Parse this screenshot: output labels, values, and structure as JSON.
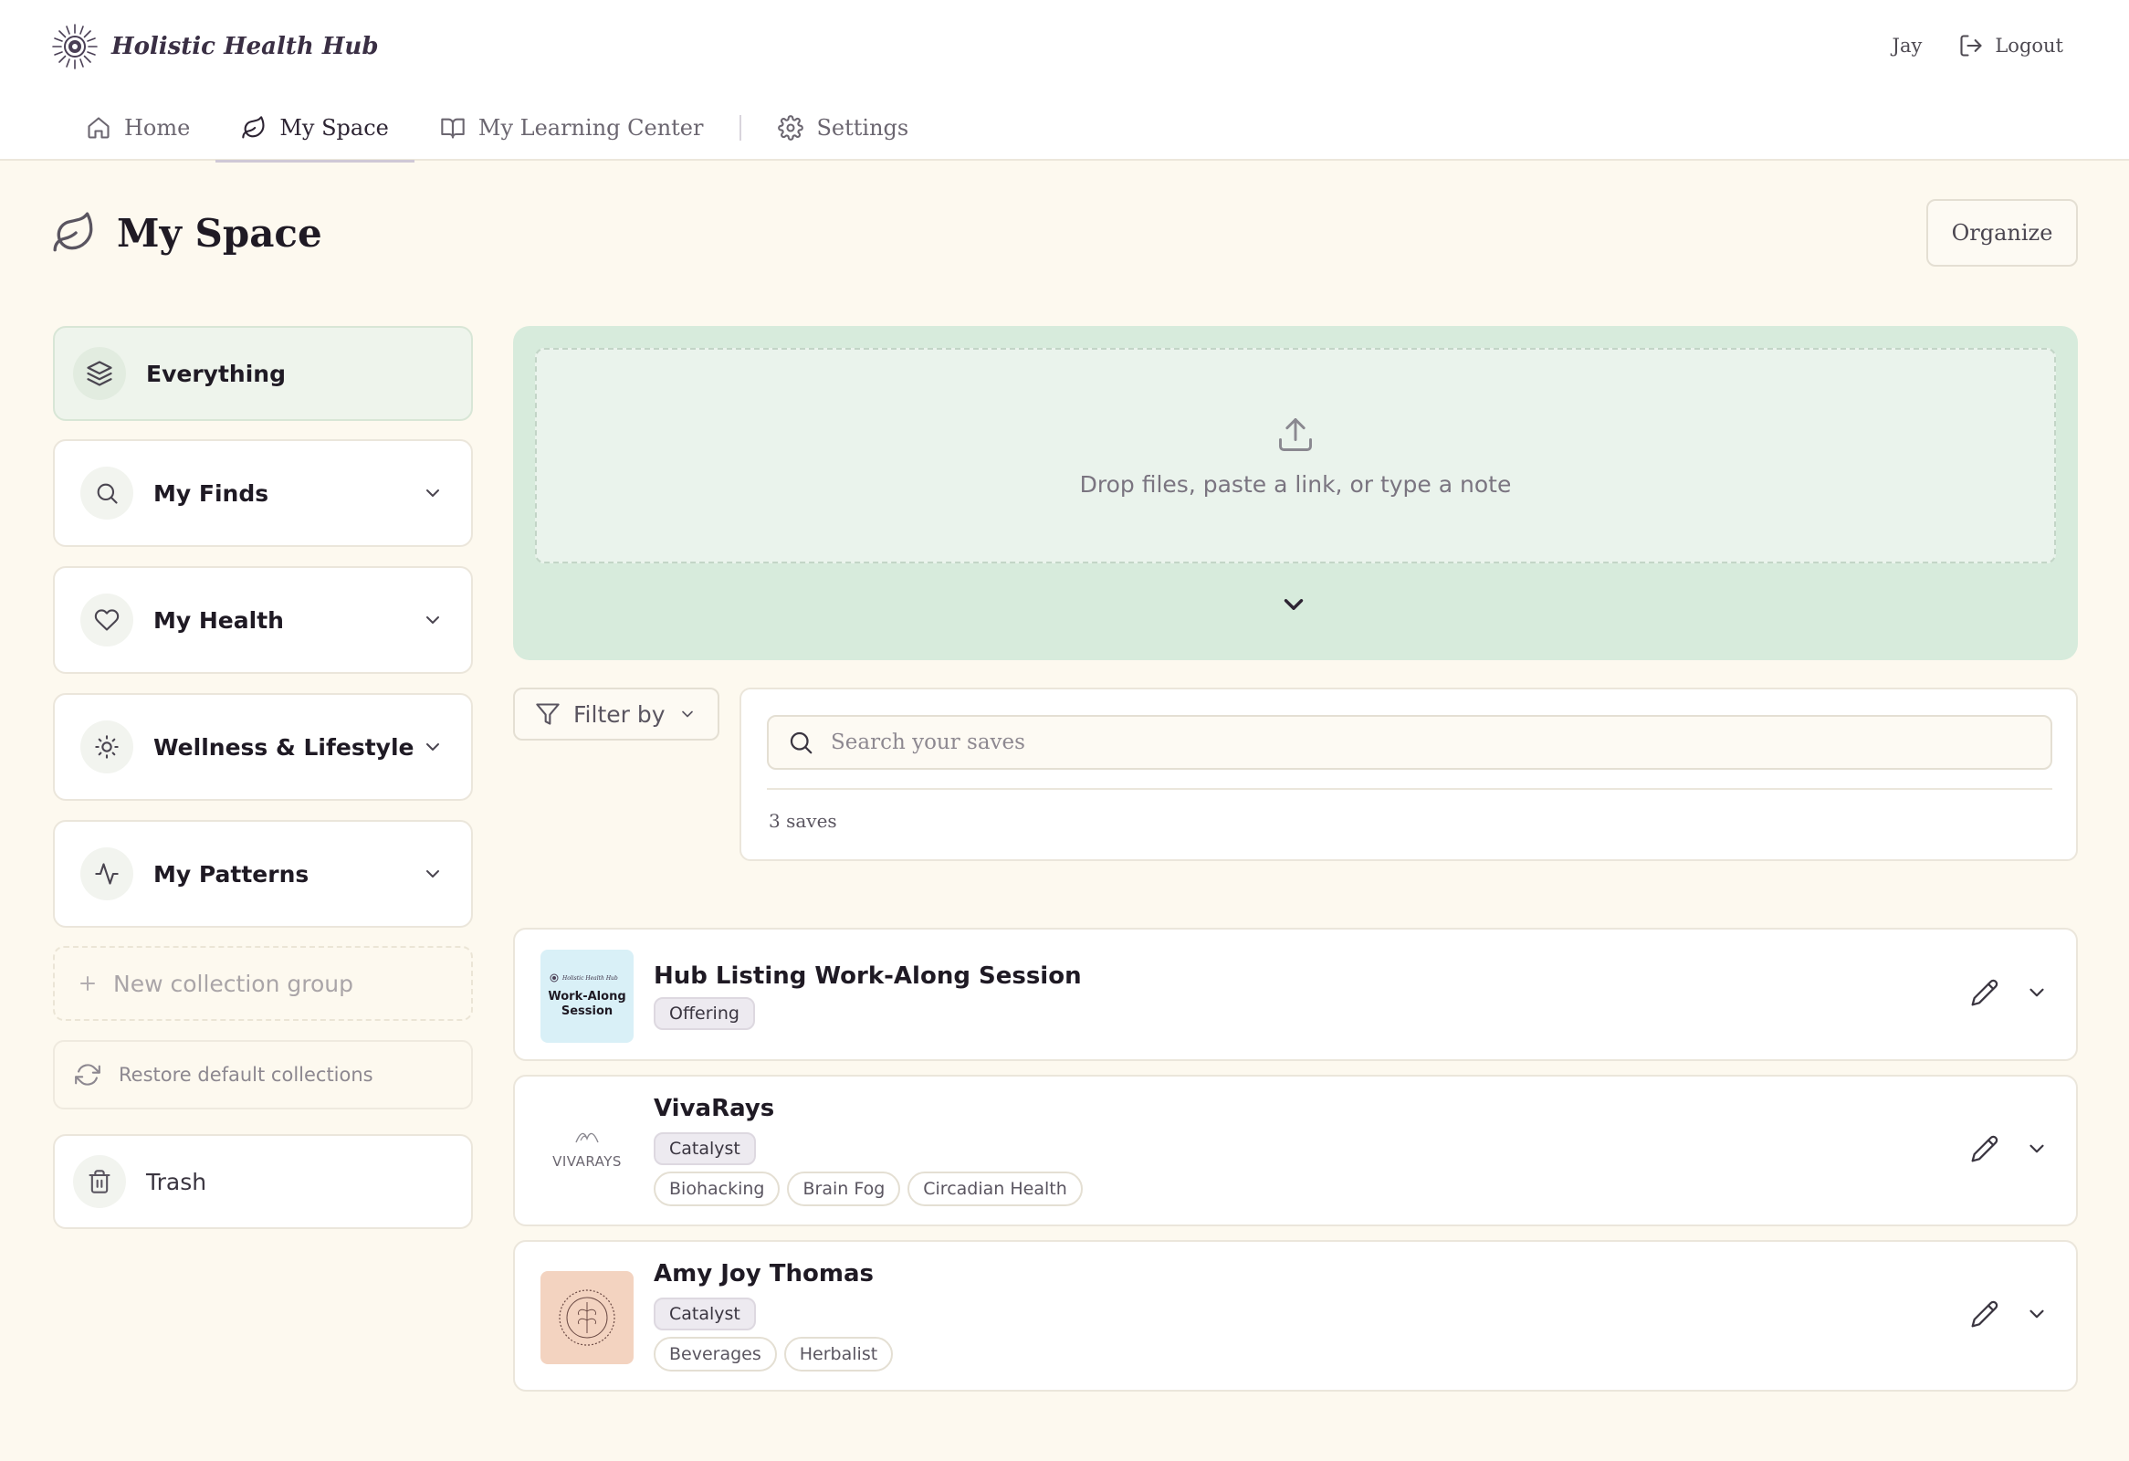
{
  "header": {
    "brand": "Holistic Health Hub",
    "user_name": "Jay",
    "logout_label": "Logout"
  },
  "nav": {
    "home": "Home",
    "my_space": "My Space",
    "learning_center": "My Learning Center",
    "settings": "Settings",
    "active": "My Space"
  },
  "page": {
    "title": "My Space",
    "organize_label": "Organize"
  },
  "sidebar": {
    "items": [
      {
        "label": "Everything",
        "icon": "layers-icon",
        "active": true
      },
      {
        "label": "My Finds",
        "icon": "search-icon"
      },
      {
        "label": "My Health",
        "icon": "heart-icon"
      },
      {
        "label": "Wellness & Lifestyle",
        "icon": "sun-icon"
      },
      {
        "label": "My Patterns",
        "icon": "activity-icon"
      }
    ],
    "new_group_label": "New collection group",
    "restore_label": "Restore default collections",
    "trash_label": "Trash"
  },
  "dropzone": {
    "text": "Drop files, paste a link, or type a note"
  },
  "filter": {
    "label": "Filter by"
  },
  "search": {
    "placeholder": "Search your saves",
    "count_text": "3 saves"
  },
  "saves": [
    {
      "title": "Hub Listing Work-Along Session",
      "type": "Offering",
      "tags": [],
      "thumb_text": [
        "Holistic Health Hub",
        "Work-Along",
        "Session"
      ]
    },
    {
      "title": "VivaRays",
      "type": "Catalyst",
      "tags": [
        "Biohacking",
        "Brain Fog",
        "Circadian Health"
      ],
      "thumb_text": [
        "VIVARAYS"
      ]
    },
    {
      "title": "Amy Joy Thomas",
      "type": "Catalyst",
      "tags": [
        "Beverages",
        "Herbalist"
      ],
      "thumb_text": []
    }
  ],
  "colors": {
    "page_bg": "#fdf9ef",
    "drop_panel": "#d7ebdc",
    "active_side": "#eef4ec",
    "thumb_blue": "#d9f0f7",
    "thumb_peach": "#f3d3c0"
  }
}
